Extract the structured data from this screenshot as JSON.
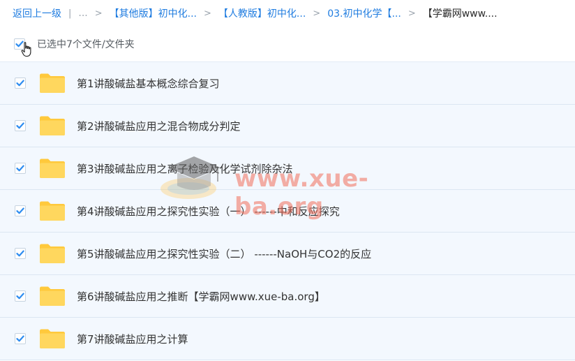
{
  "breadcrumb": {
    "back_label": "返回上一级",
    "more_label": "...",
    "sep": ">",
    "items": [
      "【其他版】初中化...",
      "【人教版】初中化...",
      "03.初中化学【...",
      "【学霸网www...."
    ]
  },
  "selection": {
    "status_text": "已选中7个文件/文件夹",
    "all_checked": true
  },
  "files": [
    {
      "name": "第1讲酸碱盐基本概念综合复习",
      "checked": true,
      "icon": "folder-icon"
    },
    {
      "name": "第2讲酸碱盐应用之混合物成分判定",
      "checked": true,
      "icon": "folder-icon"
    },
    {
      "name": "第3讲酸碱盐应用之离子检验及化学试剂除杂法",
      "checked": true,
      "icon": "folder-icon"
    },
    {
      "name": "第4讲酸碱盐应用之探究性实验（一） ------中和反应探究",
      "checked": true,
      "icon": "folder-icon"
    },
    {
      "name": "第5讲酸碱盐应用之探究性实验（二） ------NaOH与CO2的反应",
      "checked": true,
      "icon": "folder-icon"
    },
    {
      "name": "第6讲酸碱盐应用之推断【学霸网www.xue-ba.org】",
      "checked": true,
      "icon": "folder-icon"
    },
    {
      "name": "第7讲酸碱盐应用之计算",
      "checked": true,
      "icon": "folder-icon"
    }
  ],
  "watermark": {
    "text": "www.xue-ba.org"
  },
  "colors": {
    "link": "#1f7ce0",
    "row_bg": "#f3f8fe",
    "check": "#2d8cf0",
    "folder": "#ffd35c"
  }
}
